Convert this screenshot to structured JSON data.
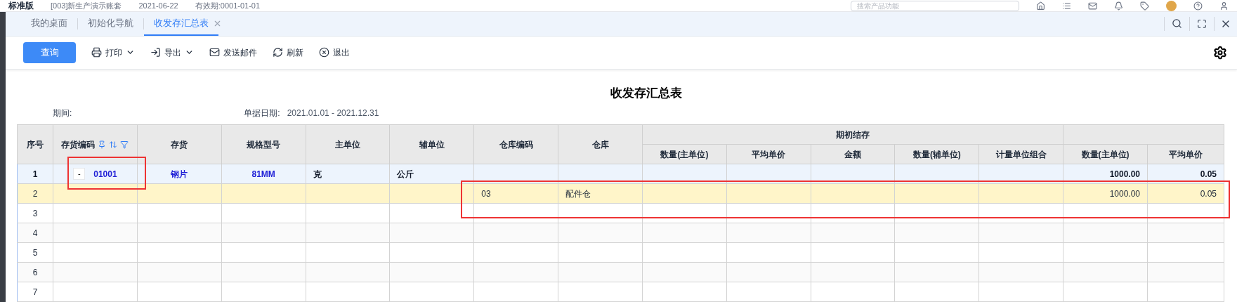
{
  "header": {
    "brand": "标准版",
    "account": "[003]新生产演示账套",
    "date": "2021-06-22",
    "validity": "有效期:0001-01-01",
    "search_placeholder": "搜索产品功能"
  },
  "tabs": [
    {
      "label": "我的桌面",
      "selected": false,
      "closable": false
    },
    {
      "label": "初始化导航",
      "selected": false,
      "closable": false
    },
    {
      "label": "收发存汇总表",
      "selected": true,
      "closable": true
    }
  ],
  "toolbar": {
    "query": "查询",
    "actions": [
      {
        "kind": "print",
        "label": "打印",
        "dropdown": true
      },
      {
        "kind": "export",
        "label": "导出",
        "dropdown": true
      },
      {
        "kind": "mail",
        "label": "发送邮件",
        "dropdown": false
      },
      {
        "kind": "refresh",
        "label": "刷新",
        "dropdown": false
      },
      {
        "kind": "exit",
        "label": "退出",
        "dropdown": false
      }
    ]
  },
  "report": {
    "title": "收发存汇总表",
    "period_label": "期间:",
    "date_label": "单据日期:",
    "date_range": "2021.01.01 - 2021.12.31"
  },
  "table": {
    "columns": [
      {
        "label": "序号"
      },
      {
        "label": "存货编码",
        "sortable": true,
        "filterable": true
      },
      {
        "label": "存货"
      },
      {
        "label": "规格型号"
      },
      {
        "label": "主单位"
      },
      {
        "label": "辅单位"
      },
      {
        "label": "仓库编码"
      },
      {
        "label": "仓库"
      },
      {
        "group": "期初结存",
        "children": [
          "数量(主单位)",
          "平均单价",
          "金额",
          "数量(辅单位)",
          "计量单位组合"
        ]
      },
      {
        "children": [
          "数量(主单位)",
          "平均单价"
        ]
      }
    ],
    "rows": [
      {
        "kind": "summary",
        "no": "1",
        "toggle": "-",
        "code": "01001",
        "item": "钢片",
        "spec": "81MM",
        "unit": "克",
        "aux_unit": "公斤",
        "qty": "1000.00",
        "price": "0.05"
      },
      {
        "kind": "detail",
        "no": "2",
        "wh_code": "03",
        "warehouse": "配件仓",
        "qty": "1000.00",
        "price": "0.05"
      },
      {
        "kind": "empty",
        "no": "3"
      },
      {
        "kind": "empty",
        "no": "4"
      },
      {
        "kind": "empty",
        "no": "5"
      },
      {
        "kind": "empty",
        "no": "6"
      },
      {
        "kind": "empty",
        "no": "7"
      }
    ]
  }
}
